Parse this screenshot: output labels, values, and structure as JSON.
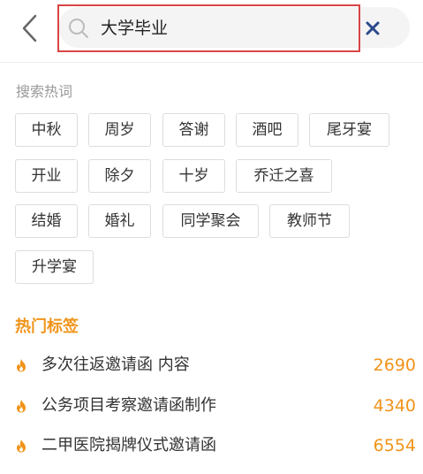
{
  "search": {
    "value": "大学毕业"
  },
  "hot_search": {
    "title": "搜索热词",
    "tags": [
      "中秋",
      "周岁",
      "答谢",
      "酒吧",
      "尾牙宴",
      "开业",
      "除夕",
      "十岁",
      "乔迁之喜",
      "结婚",
      "婚礼",
      "同学聚会",
      "教师节",
      "升学宴"
    ]
  },
  "hot_tags": {
    "title": "热门标签",
    "items": [
      {
        "text": "多次往返邀请函 内容",
        "count": "2690"
      },
      {
        "text": "公务项目考察邀请函制作",
        "count": "4340"
      },
      {
        "text": "二甲医院揭牌仪式邀请函",
        "count": "6554"
      }
    ]
  },
  "colors": {
    "accent": "#f0941a",
    "highlight": "#d94545",
    "tag_border": "#dddddd"
  }
}
